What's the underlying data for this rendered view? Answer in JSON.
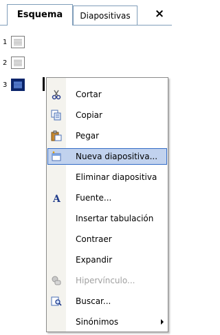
{
  "tabs": [
    {
      "label": "Esquema",
      "active": true
    },
    {
      "label": "Diapositivas",
      "active": false
    }
  ],
  "close_glyph": "×",
  "slides": [
    {
      "number": "1",
      "selected": false
    },
    {
      "number": "2",
      "selected": false
    },
    {
      "number": "3",
      "selected": true
    }
  ],
  "menu": {
    "items": [
      {
        "label": "Cortar",
        "icon": "scissors-icon",
        "enabled": true
      },
      {
        "label": "Copiar",
        "icon": "copy-icon",
        "enabled": true
      },
      {
        "label": "Pegar",
        "icon": "paste-icon",
        "enabled": true
      },
      {
        "label": "Nueva diapositiva...",
        "icon": "new-slide-icon",
        "enabled": true,
        "highlighted": true
      },
      {
        "label": "Eliminar diapositiva",
        "icon": "",
        "enabled": true
      },
      {
        "label": "Fuente...",
        "icon": "font-icon",
        "enabled": true
      },
      {
        "label": "Insertar tabulación",
        "icon": "",
        "enabled": true
      },
      {
        "label": "Contraer",
        "icon": "",
        "enabled": true
      },
      {
        "label": "Expandir",
        "icon": "",
        "enabled": true
      },
      {
        "label": "Hipervínculo...",
        "icon": "hyperlink-icon",
        "enabled": false
      },
      {
        "label": "Buscar...",
        "icon": "search-icon",
        "enabled": true
      },
      {
        "label": "Sinónimos",
        "icon": "",
        "enabled": true,
        "submenu": true
      }
    ]
  },
  "colors": {
    "highlight_bg": "#c1d2ee",
    "highlight_border": "#316ac5",
    "selection_blue": "#0a246a"
  }
}
